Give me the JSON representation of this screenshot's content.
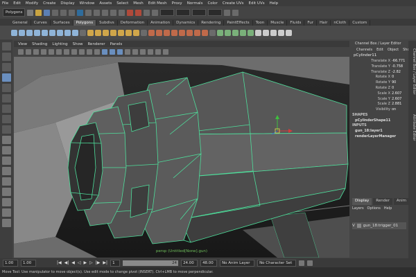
{
  "menubar": [
    "File",
    "Edit",
    "Modify",
    "Create",
    "Display",
    "Window",
    "Assets",
    "Select",
    "Mesh",
    "Edit Mesh",
    "Proxy",
    "Normals",
    "Color",
    "Create UVs",
    "Edit UVs",
    "Help"
  ],
  "statusline": {
    "menuset": "Polygons"
  },
  "shelf_tabs": [
    "General",
    "Curves",
    "Surfaces",
    "Polygons",
    "Subdivs",
    "Deformation",
    "Animation",
    "Dynamics",
    "Rendering",
    "PaintEffects",
    "Toon",
    "Muscle",
    "Fluids",
    "Fur",
    "Hair",
    "nCloth",
    "Custom"
  ],
  "active_shelf_tab": "Polygons",
  "viewport": {
    "menu": [
      "View",
      "Shading",
      "Lighting",
      "Show",
      "Renderer",
      "Panels"
    ],
    "camera_label": "persp (Untitled[None].gun)",
    "wire_color": "#4ee09c"
  },
  "channel_box": {
    "title": "Channel Box / Layer Editor",
    "menu": [
      "Channels",
      "Edit",
      "Object",
      "Show"
    ],
    "object_name": "pCylinder11",
    "attributes": [
      {
        "name": "Translate X",
        "value": "-66.771"
      },
      {
        "name": "Translate Y",
        "value": "-0.758"
      },
      {
        "name": "Translate Z",
        "value": "-2.82"
      },
      {
        "name": "Rotate X",
        "value": "0"
      },
      {
        "name": "Rotate Y",
        "value": "90"
      },
      {
        "name": "Rotate Z",
        "value": "0"
      },
      {
        "name": "Scale X",
        "value": "2.607"
      },
      {
        "name": "Scale Y",
        "value": "2.607"
      },
      {
        "name": "Scale Z",
        "value": "2.881"
      },
      {
        "name": "Visibility",
        "value": "on"
      }
    ],
    "shapes_label": "SHAPES",
    "shape_name": "pCylinderShape11",
    "inputs_label": "INPUTS",
    "inputs": [
      "gun_18:layer1",
      "renderLayerManager"
    ]
  },
  "layer_editor": {
    "tabs": [
      "Display",
      "Render",
      "Anim"
    ],
    "menu": [
      "Layers",
      "Options",
      "Help"
    ],
    "layer": {
      "visibility": "V",
      "name": "gun_18:trigger_01"
    }
  },
  "side_tabs": [
    "Channel Box / Layer Editor",
    "Attribute Editor"
  ],
  "timeline": {
    "start": "1.00",
    "current": "1.00",
    "range_start": "1",
    "range_end": "24",
    "end": "24.00",
    "max": "48.00",
    "anim_layer": "No Anim Layer",
    "char_set": "No Character Set"
  },
  "help_line": "Move Tool: Use manipulator to move object(s). Use edit mode to change pivot (INSERT). Ctrl+LMB to move perpendicular."
}
